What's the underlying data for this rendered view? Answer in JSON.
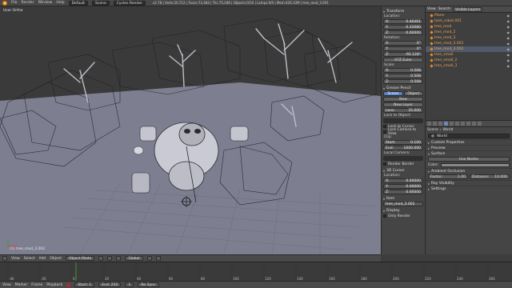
{
  "topbar": {
    "menus": [
      "File",
      "Render",
      "Window",
      "Help"
    ],
    "layout": "Default",
    "scene": "Scene",
    "engine": "Cycles Render",
    "stats": "v2.78 | Verts:20,712 | Faces:72,484 | Tris:75,048 | Objects:0/10 | Lamps:0/0 | Mem:426.33M | tree_mod_3.001"
  },
  "viewport": {
    "label": "User Ortho",
    "object_name": "(1) tree_mod_3.002",
    "header": {
      "menus": [
        "View",
        "Select",
        "Add",
        "Object"
      ],
      "mode": "Object Mode",
      "pivot": "Global"
    }
  },
  "npanel": {
    "transform": "Transform",
    "location_label": "Location:",
    "location": [
      [
        "X:",
        "0.46461"
      ],
      [
        "Y:",
        "0.32680"
      ],
      [
        "Z:",
        "0.00000"
      ]
    ],
    "rotation_label": "Rotation:",
    "rotation": [
      [
        "X:",
        "0°"
      ],
      [
        "Y:",
        "0°"
      ],
      [
        "Z:",
        "-92.128°"
      ]
    ],
    "rotation_mode": "XYZ Euler",
    "scale_label": "Scale:",
    "scale": [
      [
        "X:",
        "0.508"
      ],
      [
        "Y:",
        "0.508"
      ],
      [
        "Z:",
        "0.508"
      ]
    ],
    "grease_pencil": "Grease Pencil",
    "gp_scene": "Scene",
    "gp_object": "Object",
    "gp_new": "New",
    "gp_new_layer": "New Layer",
    "lens_label": "Lens:",
    "lens": "35.000",
    "lock_to_object": "Lock to Object:",
    "lock_cursor": "Lock to Cursor",
    "lock_camera": "Lock Camera to View",
    "clip_label": "Clip:",
    "clip_start": [
      "Start:",
      "0.100"
    ],
    "clip_end": [
      "End:",
      "1000.000"
    ],
    "local_camera": "Local Camera:",
    "render_border": "Render Border",
    "cursor_3d": "3D Cursor",
    "cursor_location": "Location:",
    "cursor": [
      [
        "X:",
        "0.00000"
      ],
      [
        "Y:",
        "0.00000"
      ],
      [
        "Z:",
        "0.00000"
      ]
    ],
    "item": "Item",
    "item_name": "tree_mod_3.002",
    "display": "Display",
    "only_render": "Only Render"
  },
  "outliner": {
    "view": "View",
    "search": "Search",
    "filter": "Visible Layers",
    "items": [
      "Plane",
      "tank_robot.001",
      "tree_mod",
      "tree_mod_2",
      "tree_mod_3",
      "tree_mod_3.001",
      "tree_mod_3.002",
      "tree_small",
      "tree_small_2",
      "tree_small_3"
    ]
  },
  "props": {
    "crumb_scene": "Scene",
    "crumb_world": "World",
    "world_name": "World",
    "sections": {
      "custom_props": "Custom Properties",
      "preview": "Preview",
      "surface": "Surface",
      "use_nodes": "Use Nodes",
      "color": "Color:",
      "ao": "Ambient Occlusion",
      "factor": [
        "Factor:",
        "1.00"
      ],
      "distance": [
        "Distance:",
        "10.000"
      ],
      "ray_vis": "Ray Visibility",
      "settings": "Settings"
    }
  },
  "timeline": {
    "menus": [
      "View",
      "Marker",
      "Frame",
      "Playback"
    ],
    "start": [
      "Start:",
      "1"
    ],
    "end": [
      "End:",
      "250"
    ],
    "current": "1",
    "sync": "No Sync",
    "ticks": [
      "-40",
      "-20",
      "0",
      "20",
      "40",
      "60",
      "80",
      "100",
      "120",
      "140",
      "160",
      "180",
      "200",
      "220",
      "240",
      "260"
    ]
  },
  "colors": {
    "accent_blue": "#5680c2",
    "object_orange": "#e98a2c",
    "ground": "#7f7f91"
  }
}
